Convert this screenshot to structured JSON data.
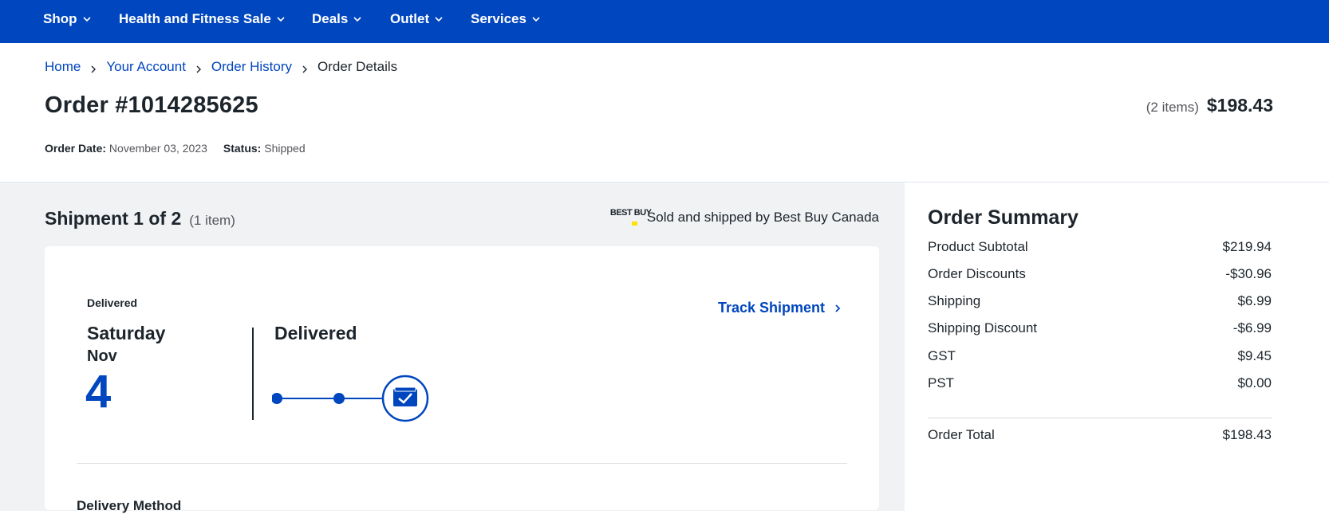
{
  "nav": {
    "items": [
      {
        "label": "Shop"
      },
      {
        "label": "Health and Fitness Sale"
      },
      {
        "label": "Deals"
      },
      {
        "label": "Outlet"
      },
      {
        "label": "Services"
      }
    ]
  },
  "breadcrumb": {
    "items": [
      "Home",
      "Your Account",
      "Order History"
    ],
    "current": "Order Details"
  },
  "order": {
    "title": "Order #1014285625",
    "items_count": "(2 items)",
    "total": "$198.43",
    "date_label": "Order Date:",
    "date_value": "November 03, 2023",
    "status_label": "Status:",
    "status_value": "Shipped"
  },
  "shipment": {
    "title": "Shipment 1 of 2",
    "subtitle": "(1 item)",
    "seller_text": "Sold and shipped by Best Buy Canada",
    "seller_logo_text": "BEST BUY",
    "delivery_status_small": "Delivered",
    "day_name": "Saturday",
    "month": "Nov",
    "day_number": "4",
    "status_big": "Delivered",
    "track_label": "Track Shipment",
    "delivery_method_label": "Delivery Method",
    "progress_steps_completed": 3,
    "progress_steps_total": 3
  },
  "summary": {
    "title": "Order Summary",
    "rows": [
      {
        "label": "Product Subtotal",
        "value": "$219.94"
      },
      {
        "label": "Order Discounts",
        "value": "-$30.96"
      },
      {
        "label": "Shipping",
        "value": "$6.99"
      },
      {
        "label": "Shipping Discount",
        "value": "-$6.99"
      },
      {
        "label": "GST",
        "value": "$9.45"
      },
      {
        "label": "PST",
        "value": "$0.00"
      }
    ],
    "total_label": "Order Total",
    "total_value": "$198.43"
  },
  "colors": {
    "brand_blue": "#0046be",
    "brand_yellow": "#ffe000",
    "page_grey": "#f0f2f4"
  }
}
